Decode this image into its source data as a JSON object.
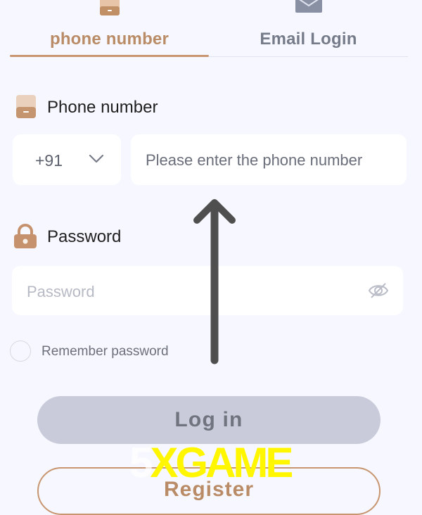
{
  "tabs": [
    {
      "label": "phone number",
      "icon": "phone-icon",
      "active": true
    },
    {
      "label": "Email Login",
      "icon": "email-icon",
      "active": false
    }
  ],
  "phone_section": {
    "title": "Phone number",
    "icon": "phone-icon",
    "country_code": "+91",
    "placeholder": "Please enter the phone number"
  },
  "password_section": {
    "title": "Password",
    "icon": "lock-icon",
    "placeholder": "Password",
    "visibility_icon": "eye-slash-icon"
  },
  "remember": {
    "label": "Remember password",
    "checked": false
  },
  "buttons": {
    "login": "Log in",
    "register": "Register"
  },
  "watermark": {
    "five": "5",
    "text": "XGAME"
  },
  "colors": {
    "accent": "#c79570",
    "background": "#f7f8ff",
    "login_button": "#c9cbdb",
    "watermark": "#fff600"
  }
}
